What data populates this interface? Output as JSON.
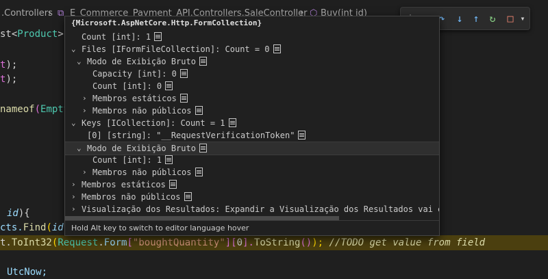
{
  "breadcrumb": {
    "item1": ".Controllers",
    "sep": "›",
    "item2": "E_Commerce_Payment_API.Controllers.SaleController",
    "item3": "Buy(int id)"
  },
  "debug_toolbar": {
    "grip": "⁞",
    "continue": "▷",
    "step_over": "↷",
    "step_into": "↓",
    "step_out": "↑",
    "restart": "↻",
    "stop": "□",
    "more": "▾"
  },
  "code": {
    "line1": [
      "st<",
      "Product",
      ">",
      "()"
    ],
    "line2": [
      "t",
      ");"
    ],
    "line3": [
      "t",
      ");"
    ],
    "line4": [
      "nameof",
      "(",
      "EmptyCart"
    ],
    "line5": [
      "id",
      "){"
    ],
    "line6": [
      "cts.",
      "Find",
      "(",
      "id"
    ],
    "line7": {
      "a": "t.",
      "b": "ToInt32",
      "c": "(",
      "d": "Request",
      "e": ".",
      "f": "Form",
      "g": "[",
      "h": "\"boughtQuantity\"",
      "i": "][",
      "j": "0",
      "k": "].",
      "l": "ToString",
      "m": "()",
      "n": ");",
      "comment": "//TODO get value from field"
    },
    "line8": "UtcNow;"
  },
  "hover": {
    "title": "{Microsoft.AspNetCore.Http.FormCollection}",
    "rows": [
      {
        "chev": "",
        "label": "Count [int]: 1"
      },
      {
        "chev": "⌄",
        "label": "Files [IFormFileCollection]: Count = 0"
      },
      {
        "chev": "⌄",
        "label": "Modo de Exibição Bruto"
      },
      {
        "chev": "",
        "label": "Capacity [int]: 0"
      },
      {
        "chev": "",
        "label": "Count [int]: 0"
      },
      {
        "chev": "›",
        "label": "Membros estáticos"
      },
      {
        "chev": "›",
        "label": "Membros não públicos"
      },
      {
        "chev": "⌄",
        "label": "Keys [ICollection]: Count = 1"
      },
      {
        "chev": "",
        "label": "[0] [string]: \"__RequestVerificationToken\""
      },
      {
        "chev": "⌄",
        "label": "Modo de Exibição Bruto"
      },
      {
        "chev": "",
        "label": "Count [int]: 1"
      },
      {
        "chev": "›",
        "label": "Membros não públicos"
      },
      {
        "chev": "›",
        "label": "Membros estáticos"
      },
      {
        "chev": "›",
        "label": "Membros não públicos"
      },
      {
        "chev": "›",
        "label": "Visualização dos Resultados: Expandir a Visualização dos Resultados vai e"
      }
    ],
    "footer": "Hold Alt key to switch to editor language hover"
  }
}
